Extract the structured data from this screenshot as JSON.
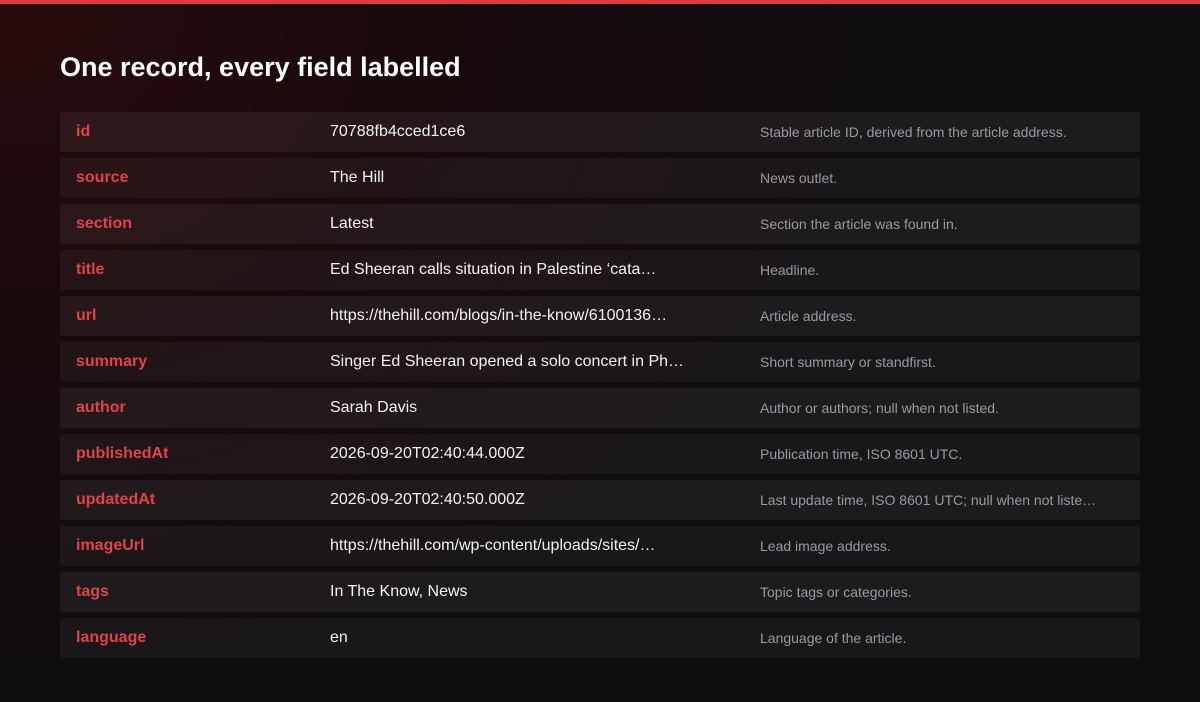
{
  "page": {
    "title": "One record, every field labelled",
    "accent_color": "#e0393f"
  },
  "rows": [
    {
      "field": "id",
      "value": "70788fb4cced1ce6",
      "description": "Stable article ID, derived from the article address."
    },
    {
      "field": "source",
      "value": "The Hill",
      "description": "News outlet."
    },
    {
      "field": "section",
      "value": "Latest",
      "description": "Section the article was found in."
    },
    {
      "field": "title",
      "value": "Ed Sheeran calls situation in Palestine ‘cata…",
      "description": "Headline."
    },
    {
      "field": "url",
      "value": "https://thehill.com/blogs/in-the-know/6100136…",
      "description": "Article address."
    },
    {
      "field": "summary",
      "value": "Singer Ed Sheeran opened a solo concert in Ph…",
      "description": "Short summary or standfirst."
    },
    {
      "field": "author",
      "value": "Sarah Davis",
      "description": "Author or authors; null when not listed."
    },
    {
      "field": "publishedAt",
      "value": "2026-09-20T02:40:44.000Z",
      "description": "Publication time, ISO 8601 UTC."
    },
    {
      "field": "updatedAt",
      "value": "2026-09-20T02:40:50.000Z",
      "description": "Last update time, ISO 8601 UTC; null when not liste…"
    },
    {
      "field": "imageUrl",
      "value": "https://thehill.com/wp-content/uploads/sites/…",
      "description": "Lead image address."
    },
    {
      "field": "tags",
      "value": "In The Know, News",
      "description": "Topic tags or categories."
    },
    {
      "field": "language",
      "value": "en",
      "description": "Language of the article."
    }
  ]
}
